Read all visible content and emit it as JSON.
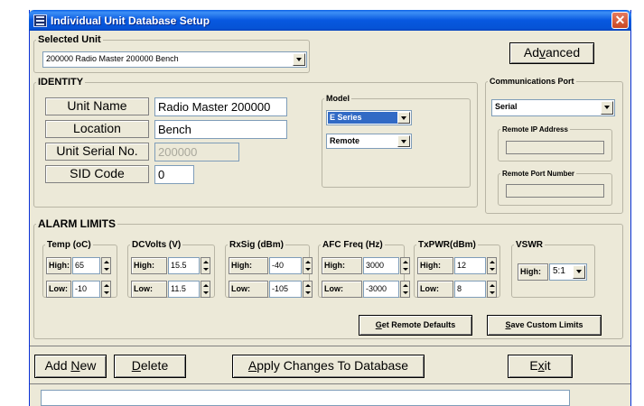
{
  "window": {
    "title": "Individual Unit Database Setup"
  },
  "selected_unit": {
    "legend": "Selected Unit",
    "value": "200000 Radio Master 200000 Bench"
  },
  "advanced_button": {
    "pre": "Ad",
    "key": "v",
    "post": "anced"
  },
  "identity": {
    "legend": "IDENTITY",
    "unit_name": {
      "label": "Unit Name",
      "value": "Radio Master 200000"
    },
    "location": {
      "label": "Location",
      "value": "Bench"
    },
    "serial": {
      "label": "Unit Serial No.",
      "value": "200000"
    },
    "sid": {
      "label": "SID Code",
      "value": "0"
    },
    "model": {
      "legend": "Model",
      "series": "E Series",
      "mode": "Remote"
    }
  },
  "comms": {
    "legend": "Communications Port",
    "port": "Serial",
    "remote_ip_legend": "Remote IP Address",
    "remote_port_legend": "Remote Port Number"
  },
  "alarms": {
    "legend": "ALARM LIMITS",
    "groups": [
      {
        "title": "Temp (oC)",
        "high_label": "High:",
        "high": "65",
        "low_label": "Low:",
        "low": "-10"
      },
      {
        "title": "DCVolts (V)",
        "high_label": "High:",
        "high": "15.5",
        "low_label": "Low:",
        "low": "11.5"
      },
      {
        "title": "RxSig (dBm)",
        "high_label": "High:",
        "high": "-40",
        "low_label": "Low:",
        "low": "-105"
      },
      {
        "title": "AFC Freq (Hz)",
        "high_label": "High:",
        "high": "3000",
        "low_label": "Low:",
        "low": "-3000"
      },
      {
        "title": "TxPWR(dBm)",
        "high_label": "High:",
        "high": "12",
        "low_label": "Low:",
        "low": "8"
      }
    ],
    "vswr": {
      "title": "VSWR",
      "high_label": "High:",
      "value": "5:1"
    },
    "get_defaults": {
      "key": "G",
      "rest": "et Remote Defaults"
    },
    "save_custom": {
      "key": "S",
      "rest": "ave Custom Limits"
    }
  },
  "bottom": {
    "add_new": {
      "pre": "Add ",
      "key": "N",
      "post": "ew"
    },
    "delete": {
      "key": "D",
      "rest": "elete"
    },
    "apply": {
      "key": "A",
      "rest": "pply Changes To Database"
    },
    "exit": {
      "pre": "E",
      "key": "x",
      "post": "it"
    }
  },
  "colors": {
    "titlebar": "#0758e0",
    "face": "#ece9d8",
    "close": "#c94622"
  }
}
